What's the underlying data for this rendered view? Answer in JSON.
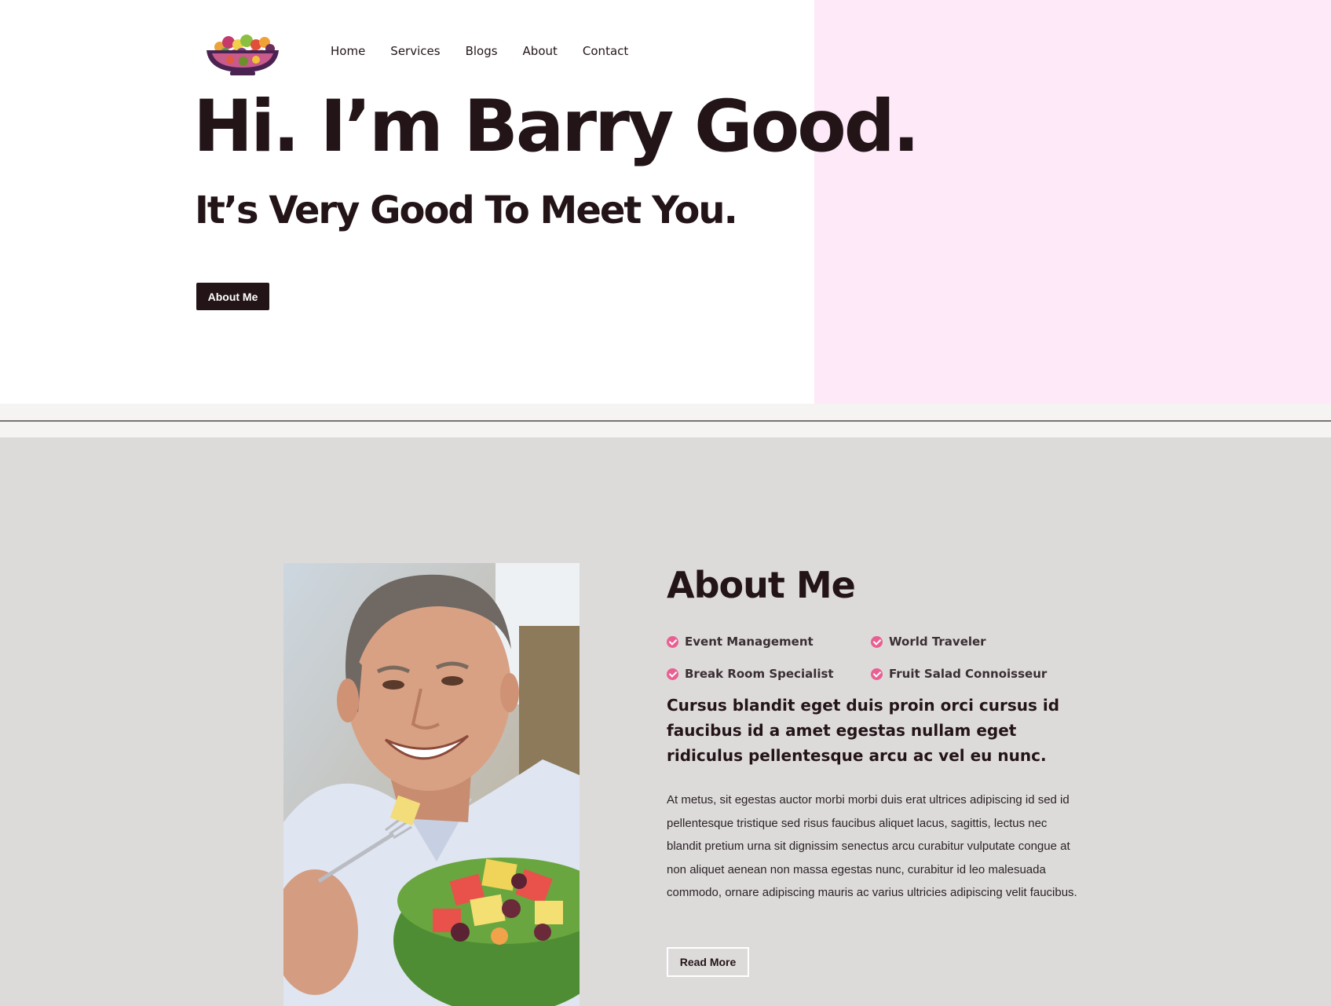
{
  "nav": {
    "items": [
      {
        "label": "Home"
      },
      {
        "label": "Services"
      },
      {
        "label": "Blogs"
      },
      {
        "label": "About"
      },
      {
        "label": "Contact"
      }
    ]
  },
  "hero": {
    "title": "Hi. I’m Barry Good.",
    "subtitle": "It’s Very Good To Meet You.",
    "button_label": "About Me"
  },
  "about": {
    "title": "About Me",
    "features": [
      {
        "label": "Event Management"
      },
      {
        "label": "World Traveler"
      },
      {
        "label": "Break Room Specialist"
      },
      {
        "label": "Fruit Salad Connoisseur"
      }
    ],
    "lead": "Cursus blandit eget duis proin orci cursus id faucibus id a amet egestas nullam eget ridiculus pellentesque arcu ac vel eu nunc.",
    "body": "At metus, sit egestas auctor morbi morbi duis erat ultrices adipiscing id sed id pellentesque tristique sed risus faucibus aliquet lacus, sagittis, lectus nec blandit pretium urna sit dignissim senectus arcu curabitur vulputate congue at non aliquet aenean non massa egestas nunc, curabitur id leo malesuada commodo, ornare adipiscing mauris ac varius ultricies adipiscing velit faucibus.",
    "button_label": "Read More"
  },
  "colors": {
    "dark": "#231418",
    "hero_accent": "#fde9f8",
    "about_bg": "#dddada",
    "check": "#ea5f92"
  },
  "icons": {
    "logo": "fruit-bowl-logo",
    "feature_bullet": "check-circle-icon"
  }
}
